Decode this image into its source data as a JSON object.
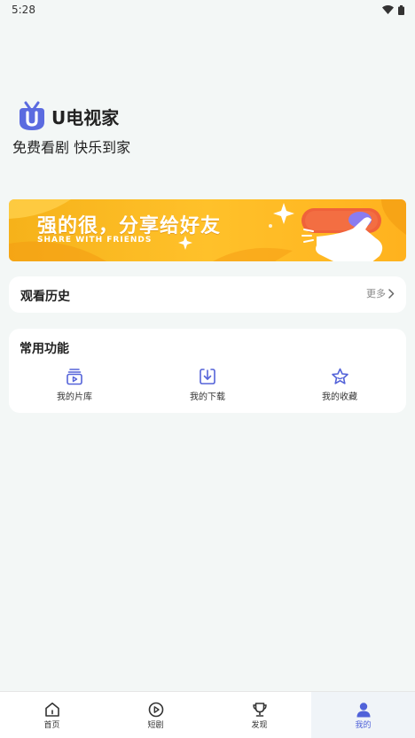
{
  "status_bar": {
    "time": "5:28",
    "icons": [
      "wifi-icon",
      "battery-icon"
    ]
  },
  "brand": {
    "name": "U电视家",
    "slogan": "免费看剧 快乐到家",
    "logo_color": "#5b6be0"
  },
  "banner": {
    "title": "强的很，分享给好友",
    "subtitle": "SHARE WITH FRIENDS",
    "bg_color": "#ffbb24",
    "button_color": "#f0623a"
  },
  "history": {
    "title": "观看历史",
    "more_label": "更多"
  },
  "functions": {
    "title": "常用功能",
    "items": [
      {
        "label": "我的片库",
        "icon": "library-icon"
      },
      {
        "label": "我的下载",
        "icon": "download-icon"
      },
      {
        "label": "我的收藏",
        "icon": "star-icon"
      }
    ],
    "icon_color": "#5564d9"
  },
  "bottom_nav": {
    "items": [
      {
        "label": "首页",
        "icon": "home-icon"
      },
      {
        "label": "短剧",
        "icon": "play-circle-icon"
      },
      {
        "label": "发现",
        "icon": "trophy-icon"
      },
      {
        "label": "我的",
        "icon": "user-icon"
      }
    ],
    "active_index": 3,
    "active_color": "#5062d9"
  }
}
